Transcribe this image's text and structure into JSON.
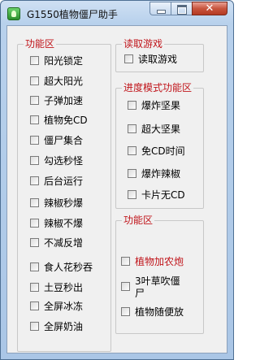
{
  "window": {
    "title": "G1550植物僵尸助手"
  },
  "titlebar_buttons": {
    "close": "✕"
  },
  "left_group": {
    "legend": "功能区",
    "items": [
      "阳光锁定",
      "超大阳光",
      "子弹加速",
      "植物免CD",
      "僵尸集合",
      "勾选秒怪",
      "后台运行",
      "辣椒秒爆",
      "辣椒不爆",
      "不减反增",
      "食人花秒吞",
      "土豆秒出",
      "全屏冰冻",
      "全屏奶油"
    ]
  },
  "read_group": {
    "legend": "读取游戏",
    "items": [
      "读取游戏"
    ]
  },
  "progress_group": {
    "legend": "进度模式功能区",
    "items": [
      "爆炸坚果",
      "超大坚果",
      "免CD时间",
      "爆炸辣椒",
      "卡片无CD"
    ]
  },
  "func_group": {
    "legend": "功能区",
    "items": [
      "植物加农炮",
      "3叶草吹僵尸",
      "植物随便放"
    ],
    "item1_line1": "3叶草吹僵",
    "item1_line2": "尸"
  },
  "colors": {
    "accent_red": "#c0141a"
  }
}
